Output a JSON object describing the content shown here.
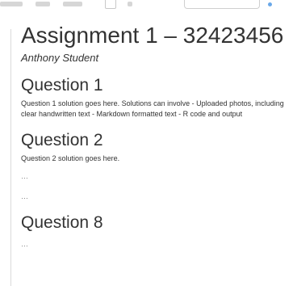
{
  "document": {
    "title": "Assignment 1 – 32423456",
    "author": "Anthony Student"
  },
  "sections": [
    {
      "heading": "Question 1",
      "text": "Question 1 solution goes here. Solutions can involve - Uploaded photos, including clear handwritten text - Markdown formatted text - R code and output"
    },
    {
      "heading": "Question 2",
      "text": "Question 2 solution goes here.",
      "ellipses": [
        "…",
        "…"
      ]
    },
    {
      "heading": "Question 8",
      "ellipses": [
        "…"
      ]
    }
  ],
  "colors": {
    "text": "#333333",
    "muted": "#777777",
    "rule": "#dadada"
  }
}
